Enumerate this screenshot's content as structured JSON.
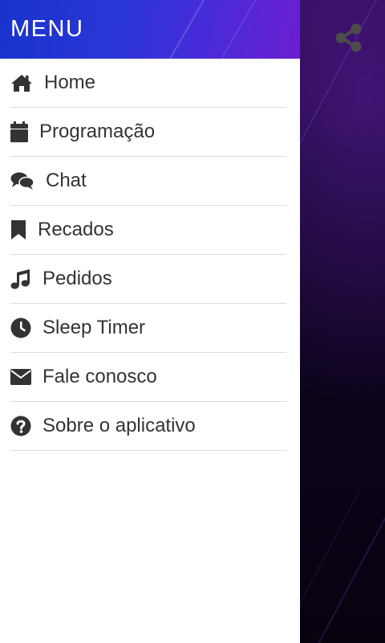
{
  "drawer": {
    "title": "MENU",
    "items": [
      {
        "label": "Home",
        "icon": "home-icon"
      },
      {
        "label": "Programação",
        "icon": "calendar-icon"
      },
      {
        "label": "Chat",
        "icon": "chat-icon"
      },
      {
        "label": "Recados",
        "icon": "bookmark-icon"
      },
      {
        "label": "Pedidos",
        "icon": "music-note-icon"
      },
      {
        "label": "Sleep Timer",
        "icon": "clock-icon"
      },
      {
        "label": "Fale conosco",
        "icon": "envelope-icon"
      },
      {
        "label": "Sobre o aplicativo",
        "icon": "question-circle-icon"
      }
    ]
  },
  "app": {
    "share_icon": "share-icon"
  },
  "colors": {
    "header_start": "#1933cc",
    "header_end": "#6b1fd0",
    "icon": "#333333",
    "text": "#333333",
    "divider": "#dcdcdc",
    "background_dark": "#0e0420"
  }
}
